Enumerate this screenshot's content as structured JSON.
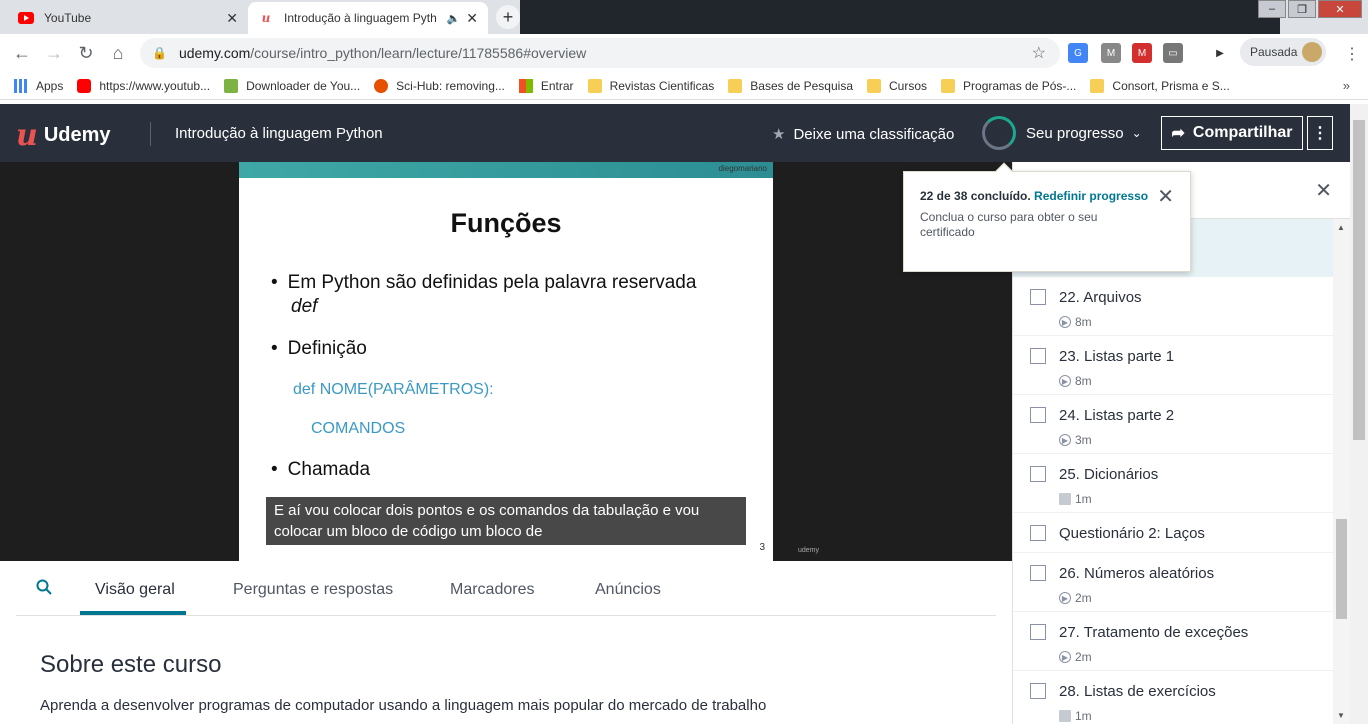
{
  "browser": {
    "tabs": [
      {
        "title": "YouTube",
        "favicon": "youtube-icon"
      },
      {
        "title": "Introdução à linguagem Pyth",
        "favicon": "udemy-icon"
      }
    ],
    "url_host": "udemy.com",
    "url_path": "/course/intro_python/learn/lecture/11785586#overview",
    "profile_label": "Pausada",
    "bookmarks": [
      {
        "label": "Apps",
        "icon": "apps-grid-icon"
      },
      {
        "label": "https://www.youtub...",
        "icon": "youtube-icon"
      },
      {
        "label": "Downloader de You...",
        "icon": "download-arrow-icon"
      },
      {
        "label": "Sci-Hub: removing...",
        "icon": "eye-icon"
      },
      {
        "label": "Entrar",
        "icon": "windows-logo-icon"
      },
      {
        "label": "Revistas Cientificas",
        "icon": "folder-icon"
      },
      {
        "label": "Bases de Pesquisa",
        "icon": "folder-icon"
      },
      {
        "label": "Cursos",
        "icon": "folder-icon"
      },
      {
        "label": "Programas de Pós-...",
        "icon": "folder-icon"
      },
      {
        "label": "Consort, Prisma e S...",
        "icon": "folder-icon"
      }
    ]
  },
  "header": {
    "logo": "Udemy",
    "course_title": "Introdução à linguagem Python",
    "rate_label": "Deixe uma classificação",
    "progress_label": "Seu progresso",
    "share_label": "Compartilhar",
    "progress_fraction": 0.58
  },
  "slide": {
    "brand": "diegomariano",
    "heading": "Funções",
    "bullet1_line1": "Em Python são definidas pela palavra reservada",
    "bullet1_line2": "def",
    "bullet2": "Definição",
    "code1": "def NOME(PARÂMETROS):",
    "code2": "COMANDOS",
    "bullet3": "Chamada",
    "page_number": "3",
    "footer_brand": "udemy"
  },
  "caption": {
    "line1": "E aí vou colocar dois pontos e os comandos da tabulação e vou",
    "line2": "colocar um bloco de código um bloco de"
  },
  "content_tabs": [
    "Visão geral",
    "Perguntas e respostas",
    "Marcadores",
    "Anúncios"
  ],
  "about": {
    "title": "Sobre este curso",
    "text": "Aprenda a desenvolver programas de computador usando a linguagem mais popular do mercado de trabalho"
  },
  "popover": {
    "status": "22 de 38 concluído.",
    "reset_link": "Redefinir progresso",
    "note": "Conclua o curso para obter o seu certificado"
  },
  "lectures": [
    {
      "title": "22. Arquivos",
      "duration": "8m",
      "type": "video"
    },
    {
      "title": "23. Listas parte 1",
      "duration": "8m",
      "type": "video"
    },
    {
      "title": "24. Listas parte 2",
      "duration": "3m",
      "type": "video"
    },
    {
      "title": "25. Dicionários",
      "duration": "1m",
      "type": "document"
    },
    {
      "title": "Questionário 2: Laços",
      "duration": "",
      "type": "quiz"
    },
    {
      "title": "26. Números aleatórios",
      "duration": "2m",
      "type": "video"
    },
    {
      "title": "27. Tratamento de exceções",
      "duration": "2m",
      "type": "video"
    },
    {
      "title": "28. Listas de exercícios",
      "duration": "1m",
      "type": "document"
    }
  ],
  "colors": {
    "udemy_red": "#ec5252",
    "header_bg": "#29303b",
    "accent_teal": "#007791",
    "code_blue": "#3b9ac3"
  }
}
